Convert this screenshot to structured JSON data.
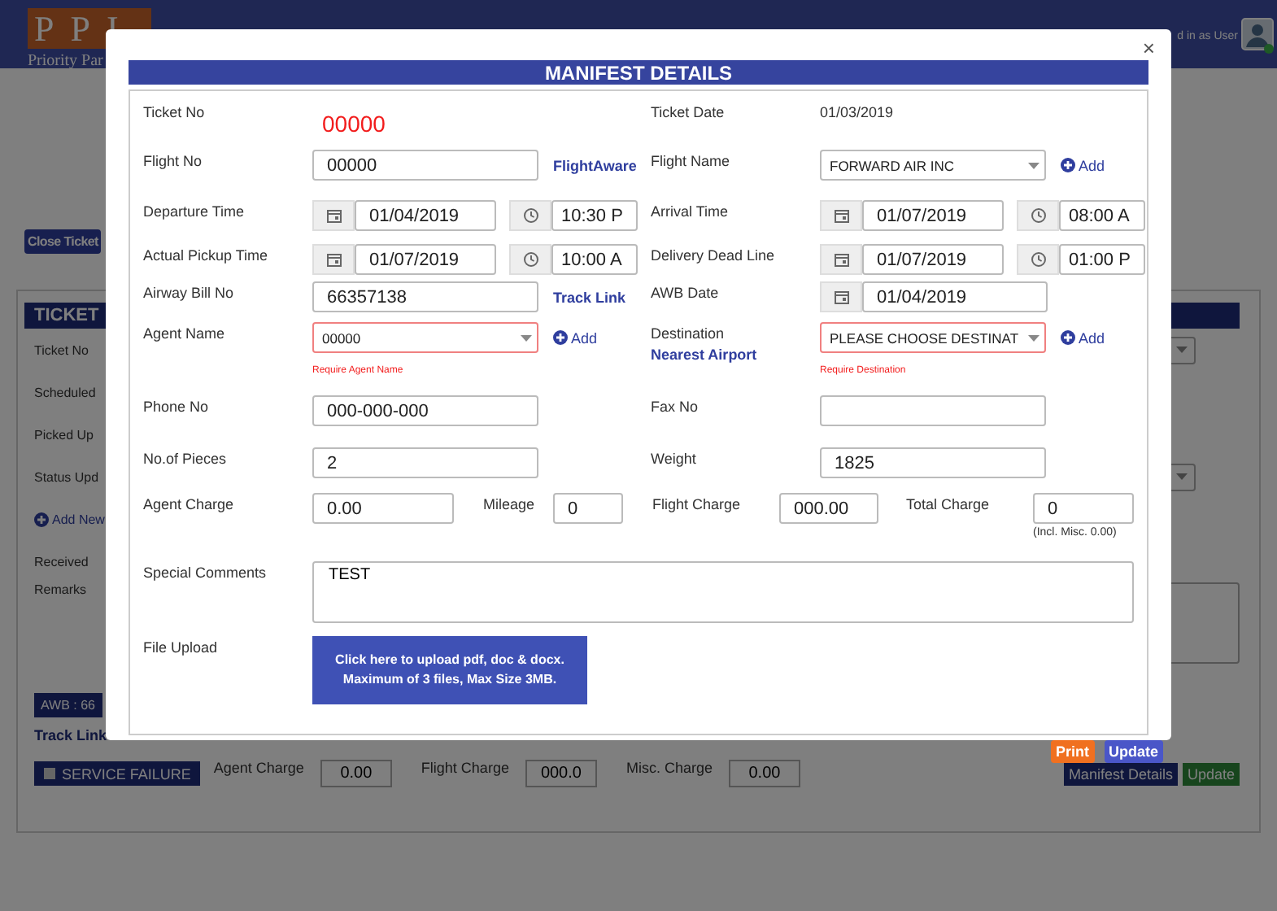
{
  "header": {
    "logo_letters": "PPI",
    "logo_tagline": "Priority Par",
    "user_text": "d in as User"
  },
  "background": {
    "close_ticket_button": "Close Ticket",
    "card_title": "TICKET",
    "rows": [
      {
        "label": "Ticket No",
        "kind": "select_stub"
      },
      {
        "label": "Scheduled",
        "kind": "plain"
      },
      {
        "label": "Picked Up",
        "kind": "plain"
      },
      {
        "label": "Status Upd",
        "kind": "select_stub"
      },
      {
        "label": "Add New",
        "kind": "add_link"
      },
      {
        "label": "Received",
        "kind": "plain"
      },
      {
        "label": "Remarks",
        "kind": "textarea_stub"
      }
    ],
    "awb_badge": "AWB : 66",
    "track_link": "Track Link",
    "service_failure": {
      "label": "SERVICE FAILURE",
      "checked": false
    },
    "charges": [
      {
        "label": "Agent Charge",
        "value": "0.00"
      },
      {
        "label": "Flight Charge",
        "value": "000.0"
      },
      {
        "label": "Misc. Charge",
        "value": "0.00"
      }
    ],
    "buttons": [
      {
        "label": "Manifest Details",
        "kind": "primary"
      },
      {
        "label": "Update",
        "kind": "success"
      }
    ]
  },
  "modal": {
    "title": "MANIFEST DETAILS",
    "close": "×",
    "rows": [
      {
        "kind": "pair",
        "left": {
          "label": "Ticket No",
          "control": {
            "kind": "big_text",
            "value": "00000"
          }
        },
        "right": {
          "label": "Ticket Date",
          "control": {
            "kind": "text",
            "value": "01/03/2019"
          }
        }
      },
      {
        "kind": "pair",
        "left": {
          "label": "Flight No",
          "control": {
            "kind": "input",
            "value": "00000"
          },
          "link": "FlightAware"
        },
        "right": {
          "label": "Flight Name",
          "control": {
            "kind": "select",
            "value": "FORWARD AIR INC",
            "invalid": false
          },
          "add": "Add"
        }
      },
      {
        "kind": "pair",
        "left": {
          "label": "Departure Time",
          "control": {
            "kind": "datetime",
            "date": "01/04/2019",
            "time": "10:30 P"
          }
        },
        "right": {
          "label": "Arrival Time",
          "control": {
            "kind": "datetime",
            "date": "01/07/2019",
            "time": "08:00 A"
          }
        }
      },
      {
        "kind": "pair",
        "left": {
          "label": "Actual Pickup Time",
          "control": {
            "kind": "datetime",
            "date": "01/07/2019",
            "time": "10:00 A"
          }
        },
        "right": {
          "label": "Delivery Dead Line",
          "control": {
            "kind": "datetime",
            "date": "01/07/2019",
            "time": "01:00 P"
          }
        }
      },
      {
        "kind": "pair",
        "left": {
          "label": "Airway Bill No",
          "control": {
            "kind": "input",
            "value": "66357138"
          },
          "link": "Track Link"
        },
        "right": {
          "label": "AWB Date",
          "control": {
            "kind": "date",
            "date": "01/04/2019"
          }
        }
      },
      {
        "kind": "pair",
        "left": {
          "label": "Agent Name",
          "control": {
            "kind": "select",
            "value": "00000",
            "invalid": true
          },
          "add": "Add",
          "error": "Require Agent Name"
        },
        "right": {
          "label": "Destination",
          "label_link": "Nearest Airport",
          "control": {
            "kind": "select",
            "value": "PLEASE CHOOSE DESTINAT",
            "invalid": true
          },
          "add": "Add",
          "error": "Require Destination"
        }
      },
      {
        "kind": "pair",
        "left": {
          "label": "Phone No",
          "control": {
            "kind": "input",
            "value": "000-000-000"
          }
        },
        "right": {
          "label": "Fax No",
          "control": {
            "kind": "input"
          }
        }
      },
      {
        "kind": "pair",
        "left": {
          "label": "No.of Pieces",
          "control": {
            "kind": "input",
            "value": "2"
          }
        },
        "right": {
          "label": "Weight",
          "control": {
            "kind": "input",
            "value": "1825"
          }
        }
      },
      {
        "kind": "charges",
        "items": [
          {
            "label": "Agent Charge",
            "value": "0.00"
          },
          {
            "label": "Mileage",
            "value": "0"
          },
          {
            "label": "Flight Charge",
            "value": "000.00"
          },
          {
            "label": "Total Charge",
            "value": "0",
            "note": "(Incl. Misc. 0.00)"
          }
        ]
      },
      {
        "kind": "textarea",
        "label": "Special Comments",
        "value": "TEST"
      },
      {
        "kind": "upload",
        "label": "File Upload",
        "lines": [
          "Click here to upload pdf, doc & docx.",
          "Maximum of 3 files, Max Size 3MB."
        ]
      }
    ],
    "footer_buttons": [
      {
        "label": "Print",
        "kind": "print"
      },
      {
        "label": "Update",
        "kind": "update"
      }
    ]
  }
}
